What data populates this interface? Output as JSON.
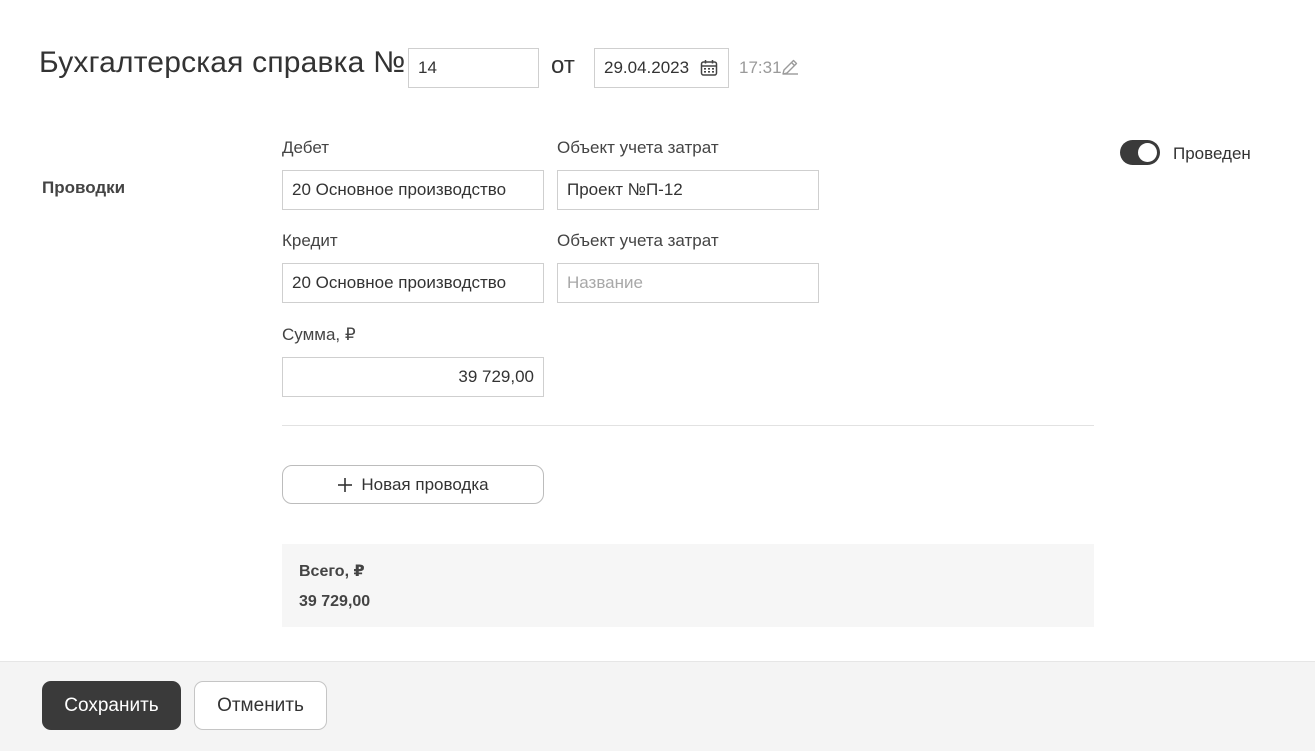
{
  "header": {
    "title": "Бухгалтерская справка №",
    "doc_number": "14",
    "from_label": "от",
    "date": "29.04.2023",
    "time": "17:31"
  },
  "status": {
    "posted_label": "Проведен",
    "posted": true
  },
  "entries": {
    "section_label": "Проводки",
    "debit_label": "Дебет",
    "debit_value": "20 Основное производство",
    "debit_cost_object_label": "Объект учета затрат",
    "debit_cost_object_value": "Проект №П-12",
    "credit_label": "Кредит",
    "credit_value": "20 Основное производство",
    "credit_cost_object_label": "Объект учета затрат",
    "credit_cost_object_placeholder": "Название",
    "amount_label": "Сумма, ₽",
    "amount_value": "39 729,00",
    "new_entry_label": "Новая проводка"
  },
  "total": {
    "label": "Всего, ₽",
    "value": "39 729,00"
  },
  "footer": {
    "save_label": "Сохранить",
    "cancel_label": "Отменить"
  },
  "icons": {
    "calendar": "calendar-icon",
    "edit": "pencil-icon",
    "add": "plus-icon"
  },
  "colors": {
    "primary_button": "#3a3a3a",
    "toggle_on": "#3a3a3a",
    "total_background": "#f6f6f6"
  }
}
